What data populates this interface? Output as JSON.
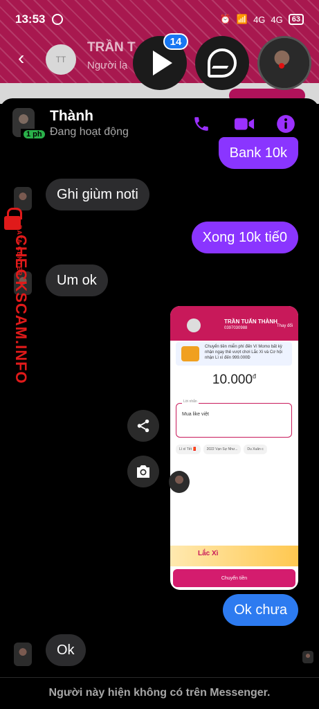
{
  "status_bar": {
    "time": "13:53",
    "signal_1": "4G",
    "signal_2": "4G",
    "battery": "63"
  },
  "background_app": {
    "back_icon": "arrow-left-icon",
    "avatar_initials": "TT",
    "contact_name": "TRẦN T",
    "contact_sub": "Người lạ"
  },
  "chat_heads": {
    "unread_badge": "14"
  },
  "chat": {
    "name": "Thành",
    "status": "Đang hoạt động",
    "online_badge": "1 ph",
    "colors": {
      "accent": "#9b30ff",
      "outgoing": "#8a35ff",
      "outgoing_blue": "#2d7bf0",
      "incoming": "#2c2c2e"
    },
    "messages": [
      {
        "direction": "out",
        "text": "Bank 10k"
      },
      {
        "direction": "in",
        "text": "Ghi giùm noti"
      },
      {
        "direction": "out",
        "text": "Xong 10k tiế0"
      },
      {
        "direction": "in",
        "text": "Um ok"
      },
      {
        "direction": "out",
        "text": "Ok chưa"
      },
      {
        "direction": "in",
        "text": "Ok"
      }
    ],
    "footer": "Người này hiện không có trên Messenger."
  },
  "attachment": {
    "contact_name": "TRẦN TUẤN THÀNH",
    "contact_phone": "0397030988",
    "change_label": "Thay đổi",
    "promo_text": "Chuyển tiền miễn phí đến Ví Momo bất kỳ nhận ngay thẻ vượt chơi Lắc Xì và Cơ hội nhận Lì xì đến 999.000Đ",
    "amount": "10.000",
    "currency": "đ",
    "note_label": "Lời nhắn",
    "note_value": "Mua like việt",
    "chips": [
      "Lì xì Tết 🧧",
      "2022 Vạn Sự Như...",
      "Du Xuân c"
    ],
    "banner_text": "Lắc Xì",
    "button_label": "Chuyển tiền"
  },
  "watermark": {
    "title": "CHECKSCAM.INFO",
    "subtitle": "DATA CENTER"
  }
}
